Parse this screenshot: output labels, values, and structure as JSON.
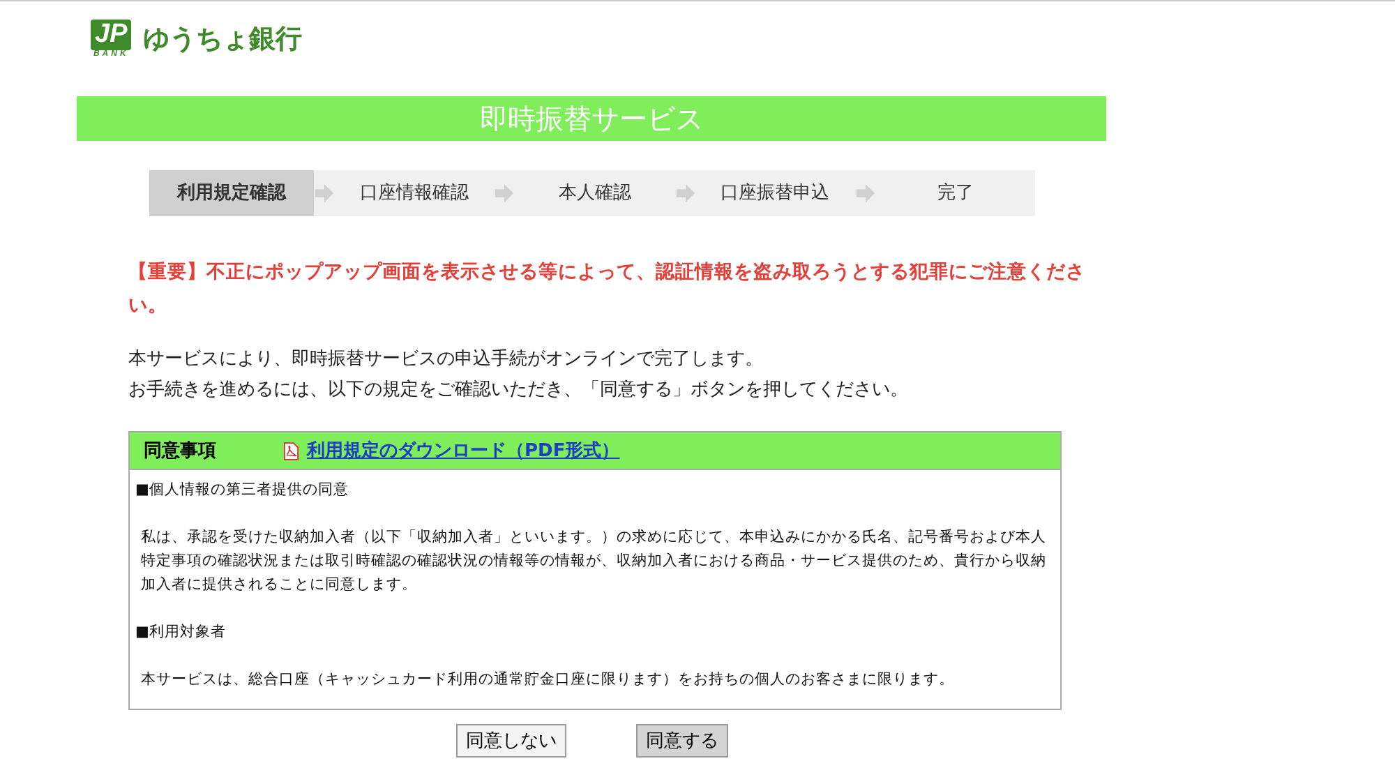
{
  "logo": {
    "mark": "JP",
    "sub": "BANK",
    "name": "ゆうちょ銀行"
  },
  "title": "即時振替サービス",
  "steps": [
    {
      "label": "利用規定確認",
      "selected": true
    },
    {
      "label": "口座情報確認",
      "selected": false
    },
    {
      "label": "本人確認",
      "selected": false
    },
    {
      "label": "口座振替申込",
      "selected": false
    },
    {
      "label": "完了",
      "selected": false
    }
  ],
  "warning": "【重要】不正にポップアップ画面を表示させる等によって、認証情報を盗み取ろうとする犯罪にご注意ください。",
  "intro": [
    "本サービスにより、即時振替サービスの申込手続がオンラインで完了します。",
    "お手続きを進めるには、以下の規定をご確認いただき、「同意する」ボタンを押してください。"
  ],
  "agreement": {
    "heading": "同意事項",
    "download_link": "利用規定のダウンロード（PDF形式）",
    "terms": [
      {
        "kind": "heading",
        "text": "■個人情報の第三者提供の同意"
      },
      {
        "kind": "paragraph",
        "text": "私は、承認を受けた収納加入者（以下「収納加入者」といいます。）の求めに応じて、本申込みにかかる氏名、記号番号および本人特定事項の確認状況または取引時確認の確認状況の情報等の情報が、収納加入者における商品・サービス提供のため、貴行から収納加入者に提供されることに同意します。"
      },
      {
        "kind": "heading",
        "text": "■利用対象者"
      },
      {
        "kind": "paragraph",
        "text": "本サービスは、総合口座（キャッシュカード利用の通常貯金口座に限ります）をお持ちの個人のお客さまに限ります。"
      }
    ]
  },
  "buttons": [
    {
      "label": "同意しない",
      "kind": "decline"
    },
    {
      "label": "同意する",
      "kind": "accept"
    }
  ]
}
